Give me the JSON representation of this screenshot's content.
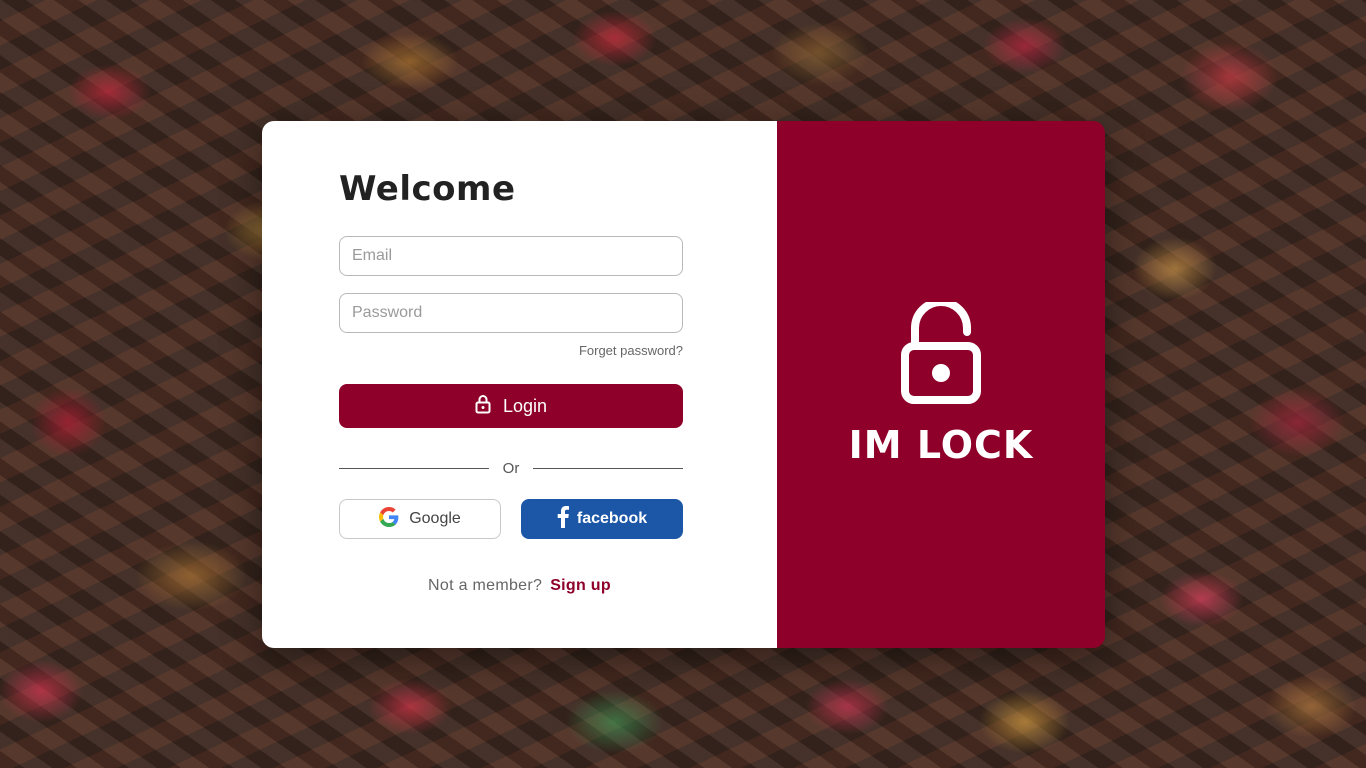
{
  "login_form": {
    "title": "Welcome",
    "email_placeholder": "Email",
    "password_placeholder": "Password",
    "forget_password_label": "Forget password?",
    "login_label": "Login",
    "divider_label": "Or",
    "google_label": "Google",
    "facebook_label": "facebook",
    "signup_prompt": "Not a member?",
    "signup_label": "Sign up"
  },
  "brand_panel": {
    "name": "IM LOCK",
    "icon": "unlocked-padlock-icon"
  },
  "colors": {
    "accent": "#8e0029",
    "facebook": "#1b56a7"
  }
}
